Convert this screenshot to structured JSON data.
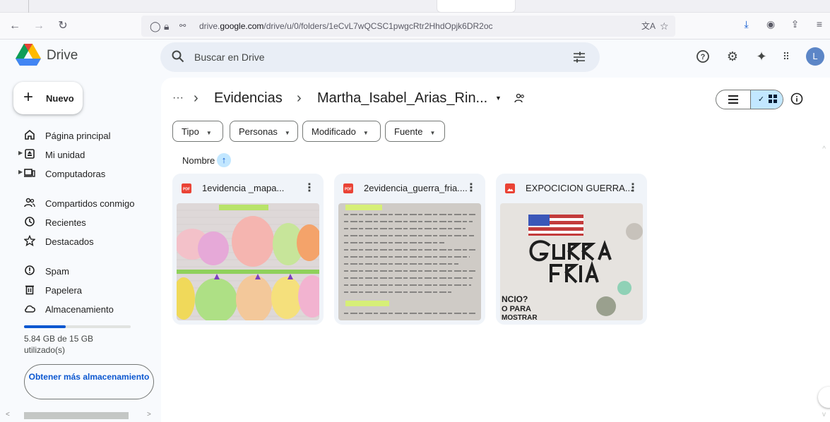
{
  "browser": {
    "url_prefix": "drive.",
    "url_domain": "google.com",
    "url_path": "/drive/u/0/folders/1eCvL7wQCSC1pwgcRtr2HhdOpjk6DR2oc"
  },
  "header": {
    "brand": "Drive",
    "search_placeholder": "Buscar en Drive",
    "avatar_letter": "L"
  },
  "sidebar": {
    "new_label": "Nuevo",
    "items": [
      {
        "label": "Página principal"
      },
      {
        "label": "Mi unidad"
      },
      {
        "label": "Computadoras"
      },
      {
        "label": "Compartidos conmigo"
      },
      {
        "label": "Recientes"
      },
      {
        "label": "Destacados"
      },
      {
        "label": "Spam"
      },
      {
        "label": "Papelera"
      },
      {
        "label": "Almacenamiento"
      }
    ],
    "storage_text": "5.84 GB de 15 GB utilizado(s)",
    "storage_fraction": 0.389,
    "get_more_label": "Obtener más almacenamiento"
  },
  "main": {
    "breadcrumb": {
      "more": "···",
      "parent": "Evidencias",
      "current": "Martha_Isabel_Arias_Rin..."
    },
    "filters": [
      {
        "label": "Tipo"
      },
      {
        "label": "Personas"
      },
      {
        "label": "Modificado"
      },
      {
        "label": "Fuente"
      }
    ],
    "sort_label": "Nombre",
    "files": [
      {
        "name": "1evidencia _mapa...",
        "type": "pdf"
      },
      {
        "name": "2evidencia_guerra_fria....",
        "type": "pdf"
      },
      {
        "name": "EXPOCICION GUERRA...",
        "type": "image"
      }
    ]
  },
  "colors": {
    "accent": "#0b57d0",
    "selected": "#c2e7ff",
    "pdf_red": "#ea4335",
    "image_red": "#ea4335"
  }
}
